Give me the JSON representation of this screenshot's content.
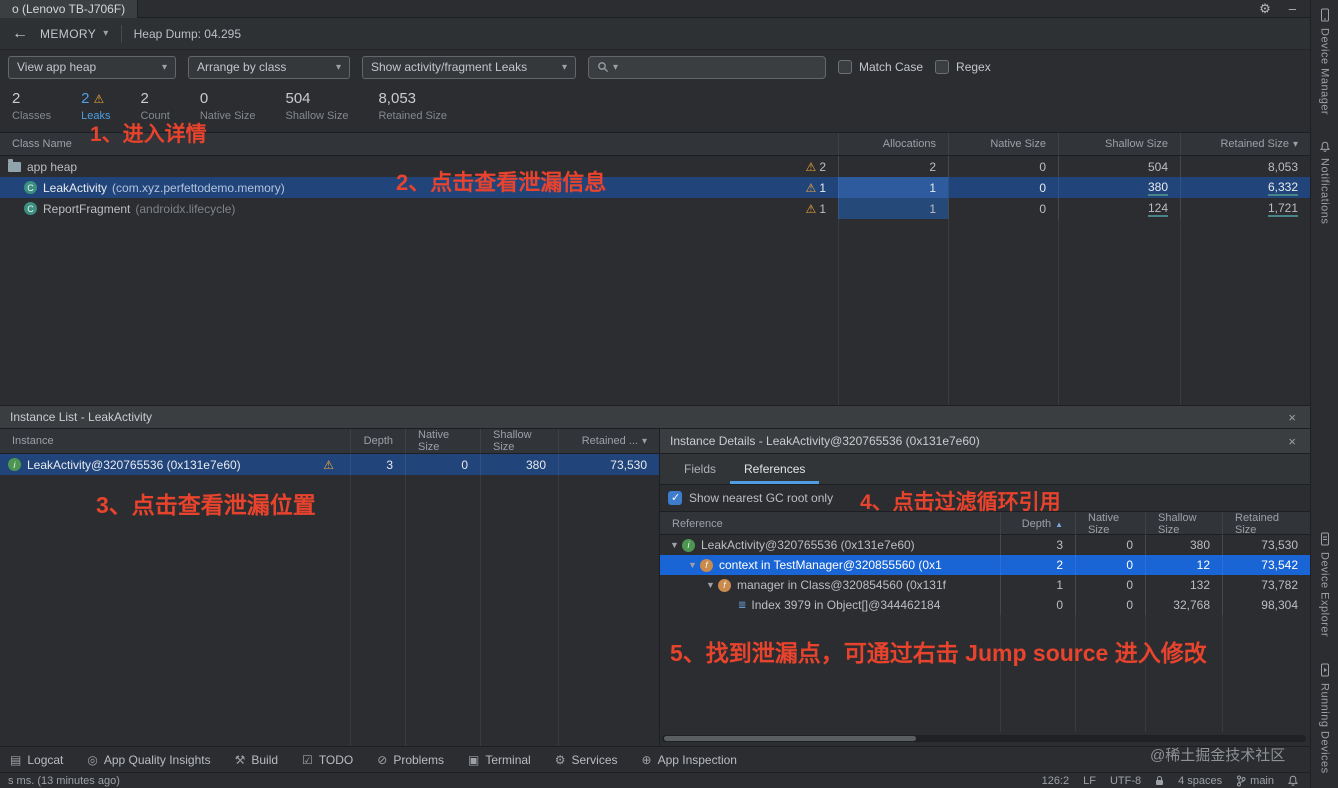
{
  "window": {
    "title_tab": "o (Lenovo TB-J706F)"
  },
  "toolbar": {
    "profiler": "MEMORY",
    "heap_dump": "Heap Dump: 04.295"
  },
  "filterbar": {
    "heap_dropdown": "View app heap",
    "arrange_dropdown": "Arrange by class",
    "show_dropdown": "Show activity/fragment Leaks",
    "search_placeholder": "",
    "match_case_label": "Match Case",
    "regex_label": "Regex"
  },
  "stats": {
    "classes": {
      "value": "2",
      "label": "Classes"
    },
    "leaks": {
      "value": "2",
      "label": "Leaks"
    },
    "count": {
      "value": "2",
      "label": "Count"
    },
    "native": {
      "value": "0",
      "label": "Native Size"
    },
    "shallow": {
      "value": "504",
      "label": "Shallow Size"
    },
    "retained": {
      "value": "8,053",
      "label": "Retained Size"
    }
  },
  "annotations": {
    "step1": "1、进入详情",
    "step2": "2、点击查看泄漏信息",
    "step3": "3、点击查看泄漏位置",
    "step4": "4、点击过滤循环引用",
    "step5": "5、找到泄漏点，可通过右击 Jump source 进入修改"
  },
  "class_table": {
    "headers": {
      "name": "Class Name",
      "alloc": "Allocations",
      "native": "Native Size",
      "shallow": "Shallow Size",
      "retained": "Retained Size"
    },
    "rows": [
      {
        "name": "app heap",
        "package": "",
        "leaks": "2",
        "alloc": "2",
        "native": "0",
        "shallow": "504",
        "retained": "8,053"
      },
      {
        "name": "LeakActivity",
        "package": "(com.xyz.perfettodemo.memory)",
        "leaks": "1",
        "alloc": "1",
        "native": "0",
        "shallow": "380",
        "retained": "6,332"
      },
      {
        "name": "ReportFragment",
        "package": "(androidx.lifecycle)",
        "leaks": "1",
        "alloc": "1",
        "native": "0",
        "shallow": "124",
        "retained": "1,721"
      }
    ]
  },
  "instance_list": {
    "title": "Instance List - LeakActivity",
    "headers": {
      "instance": "Instance",
      "depth": "Depth",
      "native": "Native Size",
      "shallow": "Shallow Size",
      "retained": "Retained ..."
    },
    "rows": [
      {
        "name": "LeakActivity@320765536 (0x131e7e60)",
        "depth": "3",
        "native": "0",
        "shallow": "380",
        "retained": "73,530"
      }
    ]
  },
  "instance_details": {
    "title": "Instance Details - LeakActivity@320765536 (0x131e7e60)",
    "tabs": {
      "fields": "Fields",
      "references": "References"
    },
    "gc_root_label": "Show nearest GC root only",
    "headers": {
      "reference": "Reference",
      "depth": "Depth",
      "native": "Native Size",
      "shallow": "Shallow Size",
      "retained": "Retained Size"
    },
    "rows": [
      {
        "name": "LeakActivity@320765536 (0x131e7e60)",
        "depth": "3",
        "native": "0",
        "shallow": "380",
        "retained": "73,530"
      },
      {
        "name": "context in TestManager@320855560 (0x1",
        "depth": "2",
        "native": "0",
        "shallow": "12",
        "retained": "73,542"
      },
      {
        "name": "manager in Class@320854560 (0x131f",
        "depth": "1",
        "native": "0",
        "shallow": "132",
        "retained": "73,782"
      },
      {
        "name": "Index 3979 in Object[]@344462184",
        "depth": "0",
        "native": "0",
        "shallow": "32,768",
        "retained": "98,304"
      }
    ]
  },
  "tool_dock": {
    "items": [
      {
        "glyph": "▤",
        "label": "Logcat"
      },
      {
        "glyph": "◎",
        "label": "App Quality Insights"
      },
      {
        "glyph": "⚒",
        "label": "Build"
      },
      {
        "glyph": "☑",
        "label": "TODO"
      },
      {
        "glyph": "⊘",
        "label": "Problems"
      },
      {
        "glyph": "▣",
        "label": "Terminal"
      },
      {
        "glyph": "⚙",
        "label": "Services"
      },
      {
        "glyph": "⊕",
        "label": "App Inspection"
      }
    ],
    "watermark": "@稀土掘金技术社区"
  },
  "status_bar": {
    "message": "s ms. (13 minutes ago)",
    "caret": "126:2",
    "line_sep": "LF",
    "encoding": "UTF-8",
    "indent": "4 spaces",
    "branch": "main"
  },
  "right_strip": {
    "items": [
      "Device Manager",
      "Notifications",
      "Device Explorer",
      "Running Devices"
    ]
  }
}
